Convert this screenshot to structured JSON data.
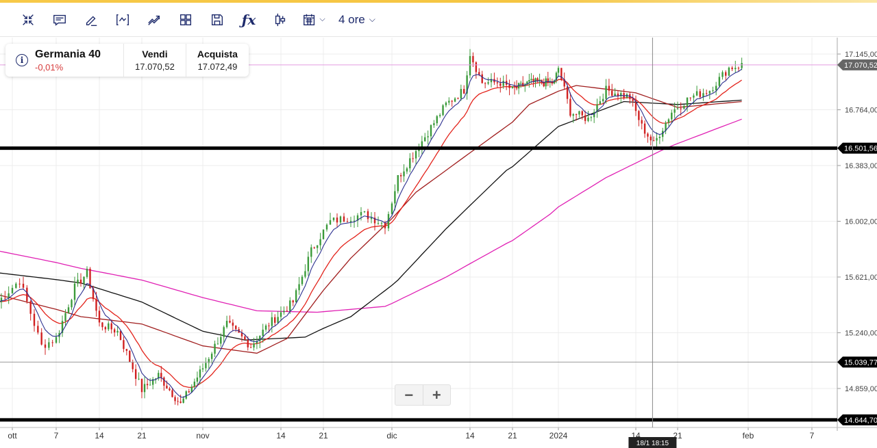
{
  "toolbar": {
    "items": [
      "collapse-icon",
      "comment-icon",
      "pencil-icon",
      "indicator-icon",
      "trend-icon",
      "layout-icon",
      "save-icon",
      "function-icon",
      "candlestick-icon",
      "calendar-icon"
    ],
    "period": "4 ore"
  },
  "instrument": {
    "name": "Germania 40",
    "change": "-0,01%",
    "sell_label": "Vendi",
    "sell": "17.070,52",
    "buy_label": "Acquista",
    "buy": "17.072,49"
  },
  "zoom": {
    "minus": "−",
    "plus": "+"
  },
  "colors": {
    "blue": "#2b2f8f",
    "red": "#e3231b",
    "darkred": "#a01d1d",
    "black": "#111111",
    "magenta": "#e020b4",
    "up": "#3a9a3a",
    "down": "#d02020"
  },
  "chart_data": {
    "type": "candlestick",
    "x_unit": "days since 1 Oct 2023",
    "x_ticks": [
      {
        "d": 0,
        "label": "ott"
      },
      {
        "d": 6,
        "label": "7"
      },
      {
        "d": 13,
        "label": "14"
      },
      {
        "d": 20,
        "label": "21"
      },
      {
        "d": 31,
        "label": "nov"
      },
      {
        "d": 44,
        "label": "14"
      },
      {
        "d": 51,
        "label": "21"
      },
      {
        "d": 61,
        "label": "dic"
      },
      {
        "d": 74,
        "label": "14"
      },
      {
        "d": 81,
        "label": "21"
      },
      {
        "d": 92,
        "label": "2024"
      },
      {
        "d": 105,
        "label": "14"
      },
      {
        "d": 112,
        "label": "21"
      },
      {
        "d": 123,
        "label": "feb"
      },
      {
        "d": 129,
        "label": "7"
      }
    ],
    "y_ticks": [
      "17.145,00",
      "16.764,00",
      "16.383,00",
      "16.002,00",
      "15.621,00",
      "15.240,00",
      "14.859,00"
    ],
    "y_tick_values": [
      17145,
      16764,
      16383,
      16002,
      15621,
      15240,
      14859
    ],
    "price": [
      [
        -2,
        15450
      ],
      [
        1,
        15600
      ],
      [
        4,
        15150
      ],
      [
        6,
        15200
      ],
      [
        9,
        15550
      ],
      [
        11,
        15650
      ],
      [
        13,
        15300
      ],
      [
        16,
        15250
      ],
      [
        20,
        14850
      ],
      [
        23,
        14950
      ],
      [
        27,
        14750
      ],
      [
        31,
        15000
      ],
      [
        35,
        15300
      ],
      [
        39,
        15150
      ],
      [
        42,
        15300
      ],
      [
        46,
        15450
      ],
      [
        49,
        15800
      ],
      [
        52,
        16000
      ],
      [
        57,
        16050
      ],
      [
        60,
        15980
      ],
      [
        62,
        16300
      ],
      [
        66,
        16550
      ],
      [
        70,
        16800
      ],
      [
        73,
        16900
      ],
      [
        74,
        17150
      ],
      [
        76,
        16950
      ],
      [
        79,
        16950
      ],
      [
        81,
        16900
      ],
      [
        85,
        16950
      ],
      [
        91,
        16950
      ],
      [
        92,
        17050
      ],
      [
        94,
        16750
      ],
      [
        97,
        16700
      ],
      [
        100,
        16900
      ],
      [
        104,
        16850
      ],
      [
        106,
        16650
      ],
      [
        108,
        16530
      ],
      [
        111,
        16750
      ],
      [
        114,
        16850
      ],
      [
        117,
        16900
      ],
      [
        120,
        17050
      ],
      [
        122,
        17070
      ]
    ],
    "ma_magenta": [
      [
        -2,
        15800
      ],
      [
        10,
        15680
      ],
      [
        20,
        15600
      ],
      [
        31,
        15480
      ],
      [
        40,
        15390
      ],
      [
        50,
        15380
      ],
      [
        60,
        15420
      ],
      [
        70,
        15620
      ],
      [
        80,
        15850
      ],
      [
        90,
        16050
      ],
      [
        100,
        16300
      ],
      [
        110,
        16500
      ],
      [
        122,
        16700
      ]
    ],
    "ma_black": [
      [
        -2,
        15650
      ],
      [
        10,
        15580
      ],
      [
        20,
        15450
      ],
      [
        31,
        15250
      ],
      [
        38,
        15190
      ],
      [
        48,
        15210
      ],
      [
        55,
        15350
      ],
      [
        62,
        15600
      ],
      [
        70,
        15950
      ],
      [
        80,
        16350
      ],
      [
        92,
        16650
      ],
      [
        103,
        16820
      ],
      [
        112,
        16800
      ],
      [
        122,
        16830
      ]
    ],
    "ma_darkred": [
      [
        -2,
        15500
      ],
      [
        10,
        15350
      ],
      [
        20,
        15300
      ],
      [
        31,
        15150
      ],
      [
        40,
        15100
      ],
      [
        45,
        15200
      ],
      [
        55,
        15750
      ],
      [
        65,
        16200
      ],
      [
        75,
        16500
      ],
      [
        85,
        16800
      ],
      [
        95,
        16930
      ],
      [
        105,
        16880
      ],
      [
        112,
        16780
      ],
      [
        122,
        16820
      ]
    ],
    "ema_red_period": 8,
    "ema_blue_period": 3,
    "levels": [
      {
        "value": 17070.52,
        "label": "17.070,52",
        "kind": "price"
      },
      {
        "value": 16501.56,
        "label": "16.501,56",
        "kind": "support"
      },
      {
        "value": 15039.77,
        "label": "15.039,77",
        "kind": "crosshair"
      },
      {
        "value": 14644.7,
        "label": "14.644,70",
        "kind": "support"
      }
    ],
    "crosshair": {
      "d": 107.8,
      "label": "18/1 18:15"
    }
  }
}
